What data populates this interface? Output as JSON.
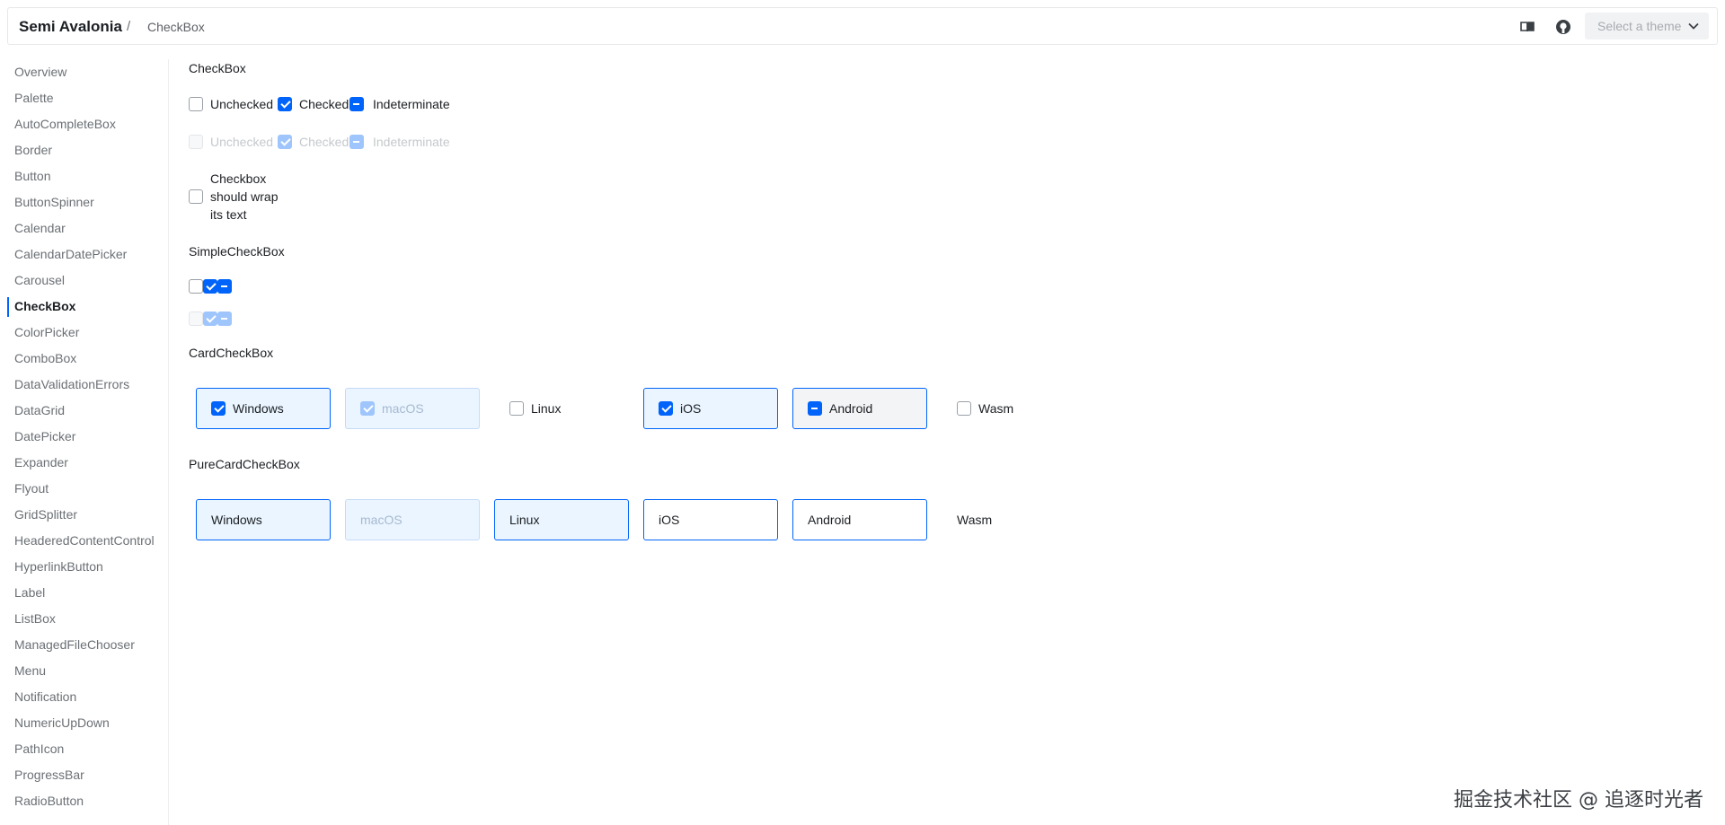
{
  "header": {
    "brand": "Semi Avalonia",
    "separator": "/",
    "breadcrumb": "CheckBox",
    "theme_placeholder": "Select a theme"
  },
  "sidebar": {
    "items": [
      {
        "label": "Overview"
      },
      {
        "label": "Palette"
      },
      {
        "label": "AutoCompleteBox"
      },
      {
        "label": "Border"
      },
      {
        "label": "Button"
      },
      {
        "label": "ButtonSpinner"
      },
      {
        "label": "Calendar"
      },
      {
        "label": "CalendarDatePicker"
      },
      {
        "label": "Carousel"
      },
      {
        "label": "CheckBox",
        "active": true
      },
      {
        "label": "ColorPicker"
      },
      {
        "label": "ComboBox"
      },
      {
        "label": "DataValidationErrors"
      },
      {
        "label": "DataGrid"
      },
      {
        "label": "DatePicker"
      },
      {
        "label": "Expander"
      },
      {
        "label": "Flyout"
      },
      {
        "label": "GridSplitter"
      },
      {
        "label": "HeaderedContentControl"
      },
      {
        "label": "HyperlinkButton"
      },
      {
        "label": "Label"
      },
      {
        "label": "ListBox"
      },
      {
        "label": "ManagedFileChooser"
      },
      {
        "label": "Menu"
      },
      {
        "label": "Notification"
      },
      {
        "label": "NumericUpDown"
      },
      {
        "label": "PathIcon"
      },
      {
        "label": "ProgressBar"
      },
      {
        "label": "RadioButton"
      }
    ]
  },
  "main": {
    "checkbox_title": "CheckBox",
    "checkbox_row": [
      "Unchecked",
      "Checked",
      "Indeterminate"
    ],
    "checkbox_wrap_label": "Checkbox should wrap its text",
    "simple_title": "SimpleCheckBox",
    "card_title": "CardCheckBox",
    "cards": [
      "Windows",
      "macOS",
      "Linux",
      "iOS",
      "Android",
      "Wasm"
    ],
    "pure_title": "PureCardCheckBox",
    "pure_cards": [
      "Windows",
      "macOS",
      "Linux",
      "iOS",
      "Android",
      "Wasm"
    ]
  },
  "watermark": "掘金技术社区 @ 追逐时光者",
  "colors": {
    "accent": "#0064fa",
    "accent_light": "#eaf5ff"
  }
}
